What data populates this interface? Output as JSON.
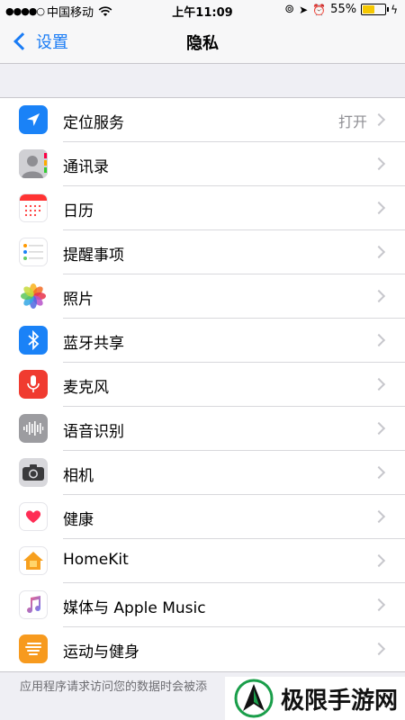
{
  "status_bar": {
    "signal": "●●●●○",
    "carrier": "中国移动",
    "wifi": "wifi-icon",
    "time": "上午11:09",
    "battery_pct": "55%",
    "battery_level": 0.55
  },
  "nav": {
    "back_label": "设置",
    "title": "隐私"
  },
  "items": [
    {
      "label": "定位服务",
      "value": "打开",
      "icon": "location-arrow-icon",
      "color": "#1a82f7"
    },
    {
      "label": "通讯录",
      "icon": "contacts-icon",
      "color": "#9a9a9e"
    },
    {
      "label": "日历",
      "icon": "calendar-icon",
      "color": "#ffffff"
    },
    {
      "label": "提醒事项",
      "icon": "reminders-icon",
      "color": "#ffffff"
    },
    {
      "label": "照片",
      "icon": "photos-icon",
      "color": "#ffffff"
    },
    {
      "label": "蓝牙共享",
      "icon": "bluetooth-icon",
      "color": "#1a82f7"
    },
    {
      "label": "麦克风",
      "icon": "microphone-icon",
      "color": "#f03b30"
    },
    {
      "label": "语音识别",
      "icon": "speech-waveform-icon",
      "color": "#9c9ca0"
    },
    {
      "label": "相机",
      "icon": "camera-icon",
      "color": "#4a4a4d"
    },
    {
      "label": "健康",
      "icon": "health-heart-icon",
      "color": "#ffffff"
    },
    {
      "label": "HomeKit",
      "icon": "homekit-house-icon",
      "color": "#ffffff"
    },
    {
      "label": "媒体与 Apple Music",
      "icon": "music-note-icon",
      "color": "#ffffff"
    },
    {
      "label": "运动与健身",
      "icon": "motion-icon",
      "color": "#f79a1e"
    }
  ],
  "footer_text": "应用程序请求访问您的数据时会被添",
  "watermark": "极限手游网"
}
